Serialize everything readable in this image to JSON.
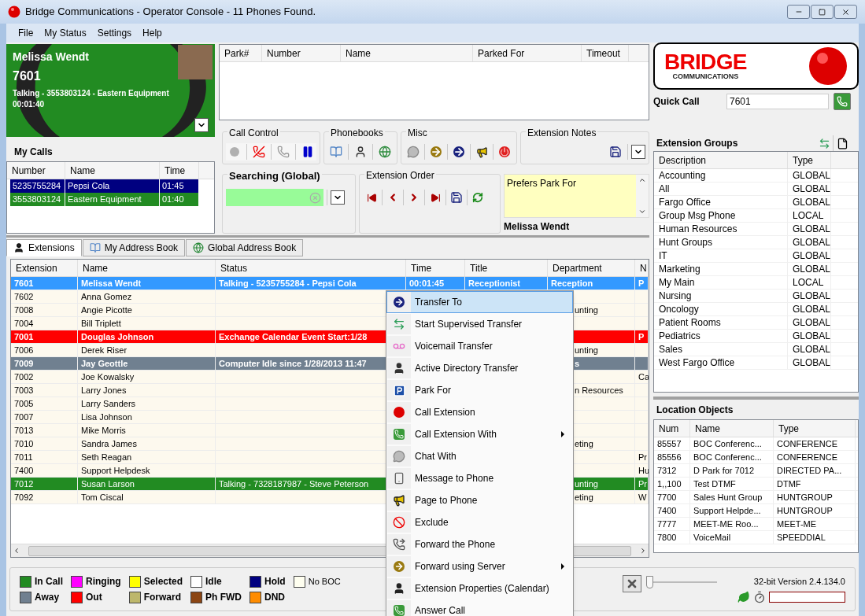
{
  "window": {
    "title": "Bridge Communications - Operator Console - 11 Phones Found."
  },
  "menu": [
    "File",
    "My Status",
    "Settings",
    "Help"
  ],
  "profile": {
    "name": "Melissa Wendt",
    "extension": "7601",
    "status": "Talking - 3553803124 - Eastern Equipment",
    "duration": "00:01:40"
  },
  "my_calls": {
    "title": "My Calls",
    "columns": [
      "Number",
      "Name",
      "Time"
    ],
    "rows": [
      {
        "number": "5235755284",
        "name": "Pepsi Cola",
        "time": "01:45",
        "color": "#000080"
      },
      {
        "number": "3553803124",
        "name": "Eastern Equipment",
        "time": "01:40",
        "color": "#228b22"
      }
    ]
  },
  "park_table": {
    "columns": [
      "Park#",
      "Number",
      "Name",
      "Parked For",
      "Timeout"
    ]
  },
  "groups": {
    "call_control": "Call Control",
    "phonebooks": "Phonebooks",
    "misc": "Misc",
    "extension_notes": "Extension Notes",
    "search": "Searching (Global)",
    "extension_order": "Extension Order"
  },
  "notes": {
    "text": "Prefers Park For",
    "owner": "Melissa Wendt"
  },
  "logo": {
    "word": "BRIDGE",
    "subtitle": "COMMUNICATIONS"
  },
  "quick_call": {
    "label": "Quick Call",
    "value": "7601"
  },
  "extension_groups": {
    "title": "Extension Groups",
    "columns": [
      "Description",
      "Type"
    ],
    "rows": [
      [
        "Accounting",
        "GLOBAL"
      ],
      [
        "All",
        "GLOBAL"
      ],
      [
        "Fargo Office",
        "GLOBAL"
      ],
      [
        "Group Msg Phone",
        "LOCAL"
      ],
      [
        "Human Resources",
        "GLOBAL"
      ],
      [
        "Hunt Groups",
        "GLOBAL"
      ],
      [
        "IT",
        "GLOBAL"
      ],
      [
        "Marketing",
        "GLOBAL"
      ],
      [
        "My Main",
        "LOCAL"
      ],
      [
        "Nursing",
        "GLOBAL"
      ],
      [
        "Oncology",
        "GLOBAL"
      ],
      [
        "Patient Rooms",
        "GLOBAL"
      ],
      [
        "Pediatrics",
        "GLOBAL"
      ],
      [
        "Sales",
        "GLOBAL"
      ],
      [
        "West Fargo Office",
        "GLOBAL"
      ]
    ]
  },
  "location_objects": {
    "title": "Location Objects",
    "columns": [
      "Num",
      "Name",
      "Type"
    ],
    "rows": [
      [
        "85557",
        "BOC Conferenc...",
        "CONFERENCE"
      ],
      [
        "85556",
        "BOC Conferenc...",
        "CONFERENCE"
      ],
      [
        "7312",
        "D Park for 7012",
        "DIRECTED PA..."
      ],
      [
        "1,,100",
        "Test DTMF",
        "DTMF"
      ],
      [
        "7700",
        "Sales Hunt Group",
        "HUNTGROUP"
      ],
      [
        "7400",
        "Support Helpde...",
        "HUNTGROUP"
      ],
      [
        "7777",
        "MEET-ME Roo...",
        "MEET-ME"
      ],
      [
        "7800",
        "VoiceMail",
        "SPEEDDIAL"
      ]
    ]
  },
  "tabs": [
    {
      "label": "Extensions",
      "selected": true
    },
    {
      "label": "My Address Book",
      "selected": false
    },
    {
      "label": "Global Address Book",
      "selected": false
    }
  ],
  "extensions": {
    "columns": [
      "Extension",
      "Name",
      "Status",
      "Time",
      "Title",
      "Department",
      "N"
    ],
    "rows": [
      {
        "extension": "7601",
        "name": "Melissa Wendt",
        "status": "Talking - 5235755284 - Pepsi Cola",
        "time": "00:01:45",
        "title": "Receptionist",
        "department": "Reception",
        "column_7": "P",
        "color": "#3399ff",
        "bold": true,
        "kind": "highlight"
      },
      {
        "extension": "7602",
        "name": "Anna Gomez",
        "color": "#fdf9ee",
        "bold": false,
        "kind": "plain"
      },
      {
        "extension": "7008",
        "name": "Angie Picotte",
        "department": "unting",
        "color": "#fdf9ee",
        "bold": false,
        "kind": "plain"
      },
      {
        "extension": "7004",
        "name": "Bill Triplett",
        "color": "#fdf9ee",
        "bold": false,
        "kind": "plain"
      },
      {
        "extension": "7001",
        "name": "Douglas Johnson",
        "status": "Exchange Calendar Event Start:1/28",
        "column_7": "P",
        "color": "#ff0000",
        "bold": true,
        "kind": "highlight"
      },
      {
        "extension": "7006",
        "name": "Derek Riser",
        "department": "unting",
        "color": "#fdf9ee",
        "bold": false,
        "kind": "plain"
      },
      {
        "extension": "7009",
        "name": "Jay Geottle",
        "status": "Computer Idle since 1/28/2013 11:47",
        "department": "s",
        "color": "#708090",
        "bold": true,
        "kind": "highlight"
      },
      {
        "extension": "7002",
        "name": "Joe Kowalsky",
        "column_7": "Ca",
        "color": "#fdf9ee",
        "bold": false,
        "kind": "plain"
      },
      {
        "extension": "7003",
        "name": "Larry Jones",
        "department": "n Resources",
        "color": "#fdf9ee",
        "bold": false,
        "kind": "plain"
      },
      {
        "extension": "7005",
        "name": "Larry Sanders",
        "color": "#fdf9ee",
        "bold": false,
        "kind": "plain"
      },
      {
        "extension": "7007",
        "name": "Lisa Johnson",
        "color": "#fdf9ee",
        "bold": false,
        "kind": "plain"
      },
      {
        "extension": "7013",
        "name": "Mike Morris",
        "color": "#fdf9ee",
        "bold": false,
        "kind": "plain"
      },
      {
        "extension": "7010",
        "name": "Sandra James",
        "department": "eting",
        "color": "#fdf9ee",
        "bold": false,
        "kind": "plain"
      },
      {
        "extension": "7011",
        "name": "Seth Reagan",
        "column_7": "Pr",
        "color": "#fdf9ee",
        "bold": false,
        "kind": "plain"
      },
      {
        "extension": "7400",
        "name": "Support Helpdesk",
        "column_7": "Hu",
        "color": "#fdf9ee",
        "bold": false,
        "kind": "plain"
      },
      {
        "extension": "7012",
        "name": "Susan Larson",
        "status": "Talking - 7328187987 - Steve Peterson",
        "department": "unting",
        "column_7": "Pr",
        "color": "#228b22",
        "bold": false,
        "kind": "highlight"
      },
      {
        "extension": "7092",
        "name": "Tom Ciscal",
        "department": "eting",
        "column_7": "W",
        "color": "#fdf9ee",
        "bold": false,
        "kind": "plain"
      }
    ]
  },
  "context_menu": [
    {
      "label": "Transfer To",
      "selected": true,
      "submenu": false
    },
    {
      "label": "Start Supervised Transfer",
      "selected": false,
      "submenu": false
    },
    {
      "label": "Voicemail Transfer",
      "selected": false,
      "submenu": false
    },
    {
      "label": "Active Directory Transfer",
      "selected": false,
      "submenu": false
    },
    {
      "label": "Park For",
      "selected": false,
      "submenu": false
    },
    {
      "label": "Call Extension",
      "selected": false,
      "submenu": false
    },
    {
      "label": "Call Extension With",
      "selected": false,
      "submenu": true
    },
    {
      "label": "Chat With",
      "selected": false,
      "submenu": false
    },
    {
      "label": "Message to Phone",
      "selected": false,
      "submenu": false
    },
    {
      "label": "Page to Phone",
      "selected": false,
      "submenu": false
    },
    {
      "label": "Exclude",
      "selected": false,
      "submenu": false
    },
    {
      "label": "Forward the Phone",
      "selected": false,
      "submenu": false
    },
    {
      "label": "Forward using Server",
      "selected": false,
      "submenu": true
    },
    {
      "label": "Extension Properties (Calendar)",
      "selected": false,
      "submenu": false
    },
    {
      "label": "Answer Call",
      "selected": false,
      "submenu": false
    }
  ],
  "legend": [
    {
      "label": "In Call",
      "color": "#228b22",
      "bold": true
    },
    {
      "label": "Away",
      "color": "#708090",
      "bold": true
    },
    {
      "label": "Ringing",
      "color": "#ff00ff",
      "bold": true
    },
    {
      "label": "Out",
      "color": "#ff0000",
      "bold": true
    },
    {
      "label": "Selected",
      "color": "#ffff00",
      "bold": true
    },
    {
      "label": "Forward",
      "color": "#bdb76b",
      "bold": true
    },
    {
      "label": "Idle",
      "color": "#ffffff",
      "bold": true
    },
    {
      "label": "Ph FWD",
      "color": "#8b4513",
      "bold": true
    },
    {
      "label": "Hold",
      "color": "#000080",
      "bold": true
    },
    {
      "label": "DND",
      "color": "#ff8c00",
      "bold": true
    },
    {
      "label": "No BOC",
      "color": "#fffff0",
      "bold": false
    }
  ],
  "footer": {
    "version": "32-bit Version 2.4.134.0",
    "volume": {
      "level": 0
    }
  }
}
